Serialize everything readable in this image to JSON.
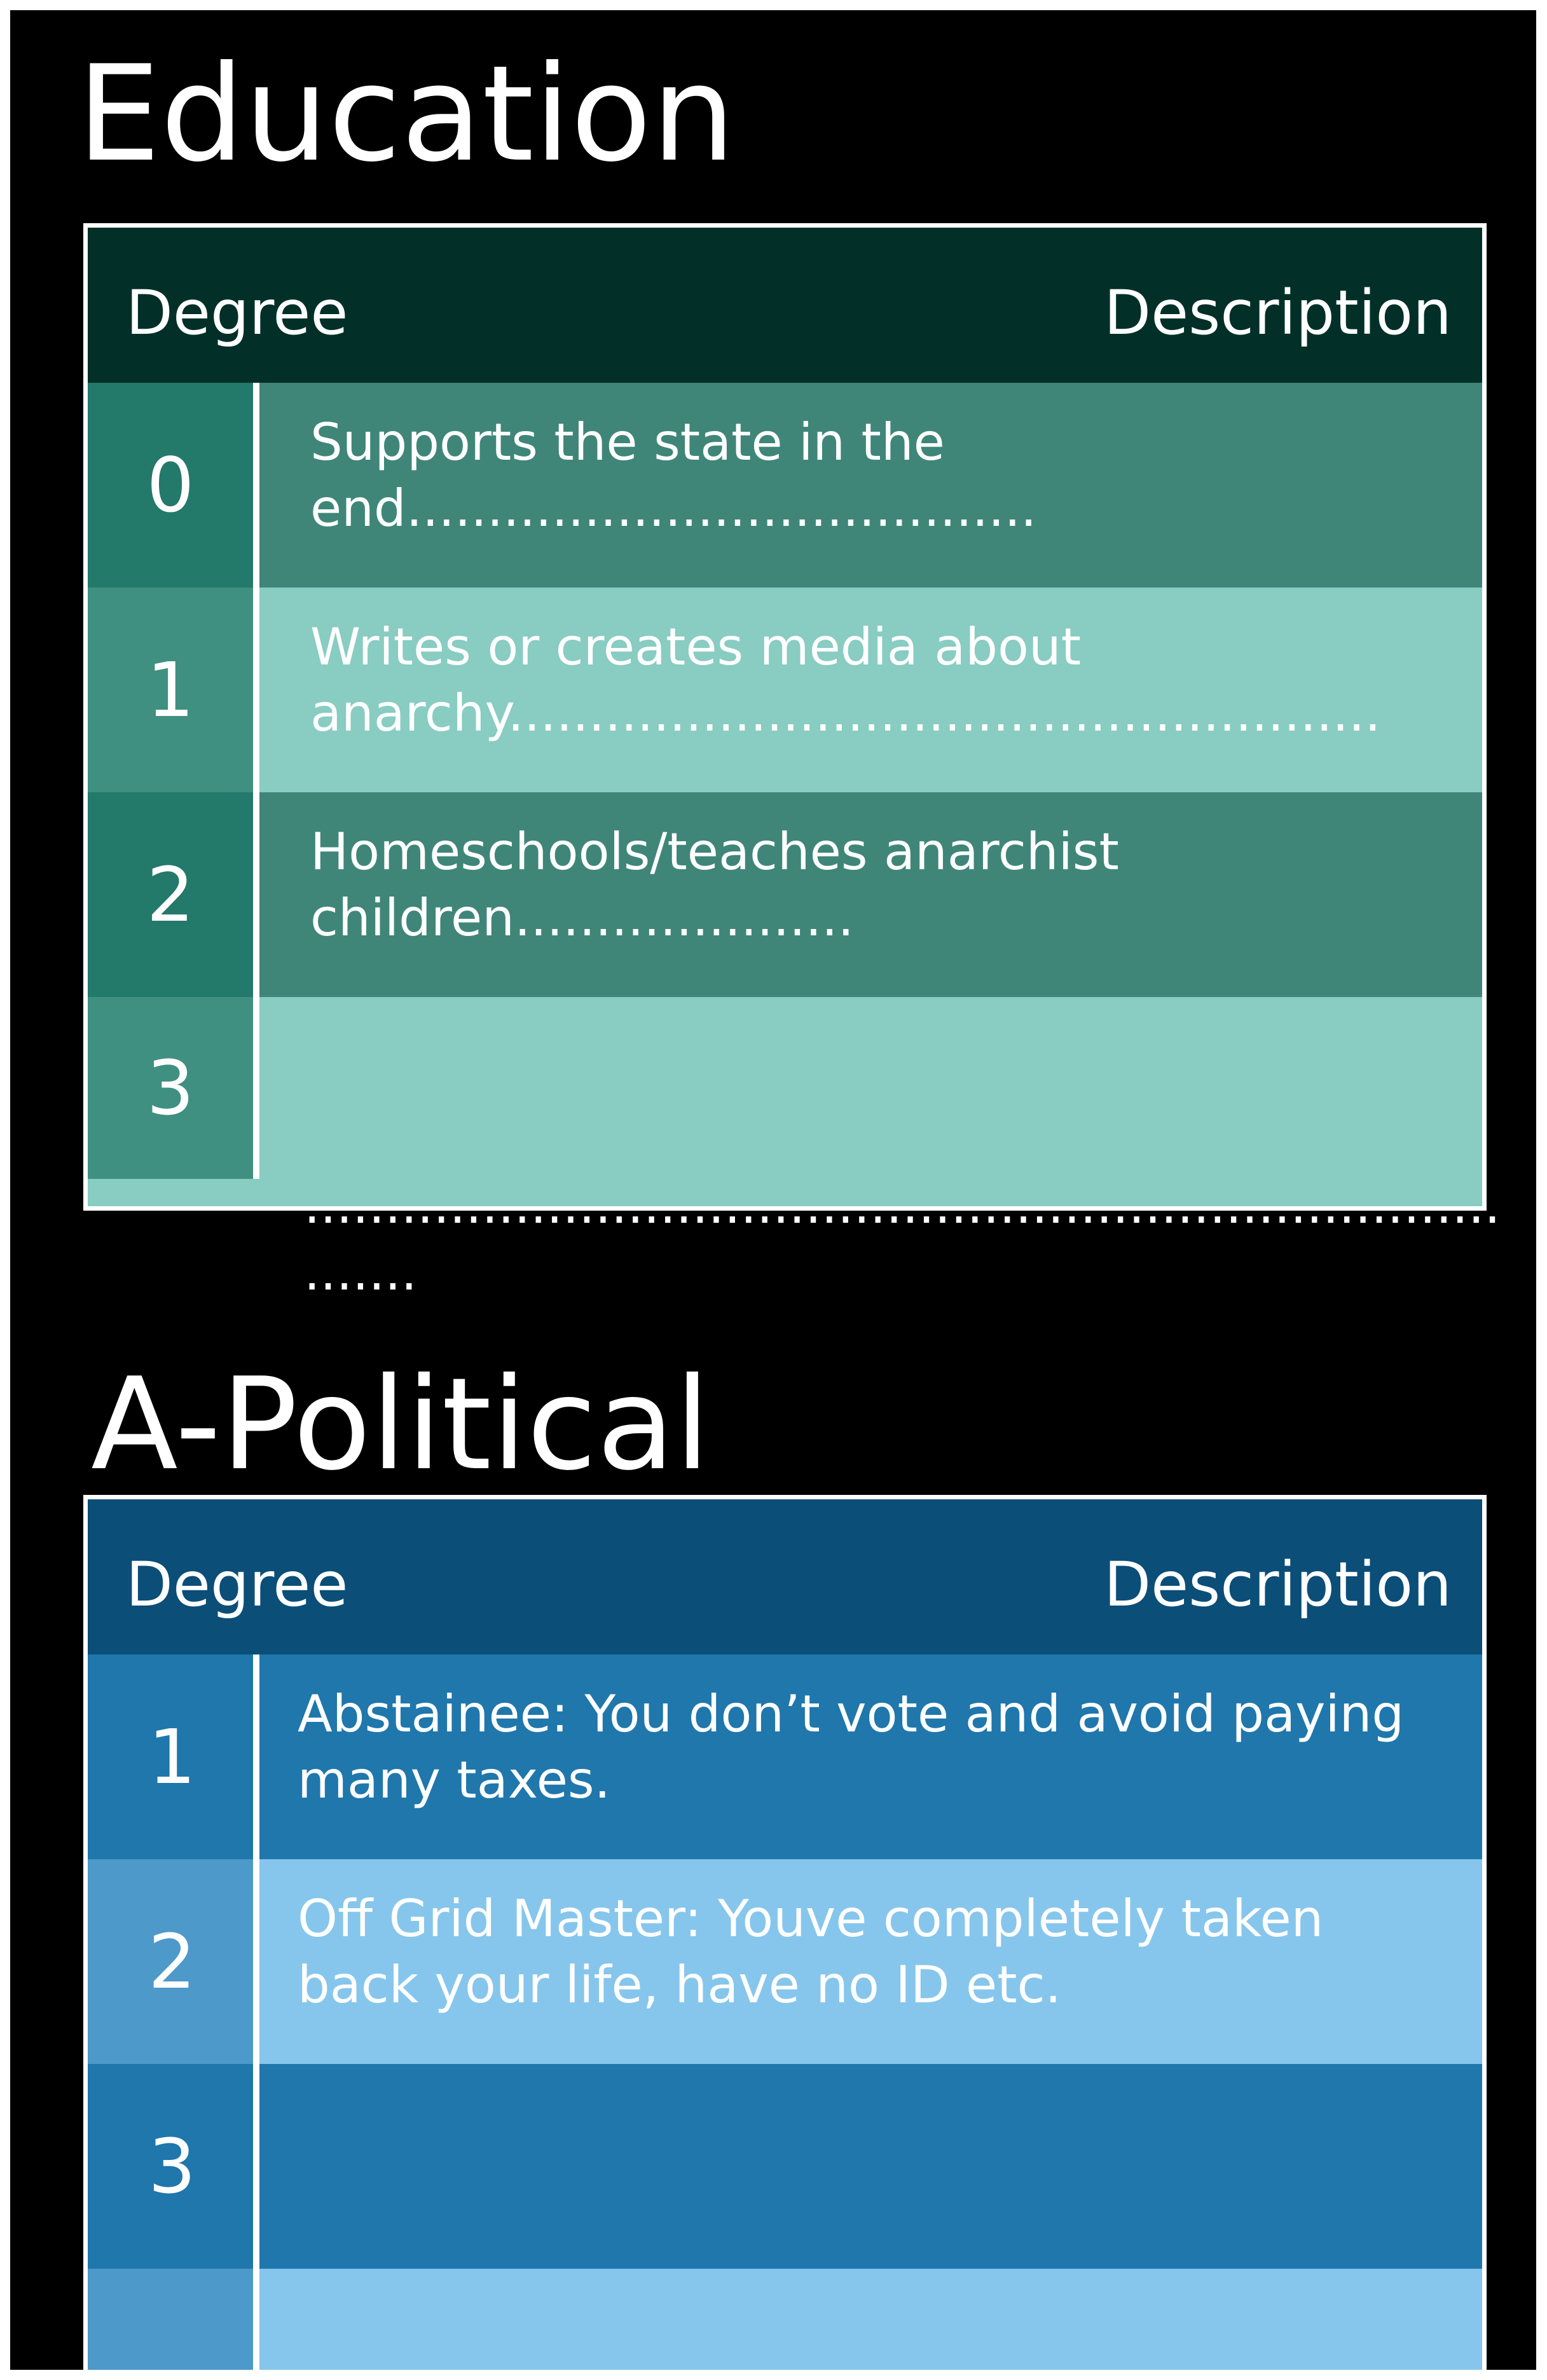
{
  "education": {
    "title": "Education",
    "header": {
      "degree": "Degree",
      "description": "Description"
    },
    "rows": [
      {
        "degree": "0",
        "description": "Supports the state in the end......................................."
      },
      {
        "degree": "1",
        "description": "Writes or creates media about anarchy......................................................"
      },
      {
        "degree": "2",
        "description": "Homeschools/teaches anarchist children....................."
      },
      {
        "degree": "3",
        "description": ""
      }
    ],
    "overflow_line1": "..........................................................................",
    "overflow_line2": "......."
  },
  "apolitical": {
    "title": "A-Political",
    "header": {
      "degree": "Degree",
      "description": "Description"
    },
    "rows": [
      {
        "degree": "1",
        "description": "Abstainee: You don’t vote and avoid paying many taxes."
      },
      {
        "degree": "2",
        "description": "Off Grid Master: Youve completely taken back your life, have no ID etc."
      },
      {
        "degree": "3",
        "description": ""
      },
      {
        "degree": "",
        "description": ""
      }
    ]
  },
  "colors": {
    "education_header": "#023028",
    "education_num_dark": "#23796A",
    "education_num_light": "#3F9080",
    "education_desc_dark": "#3F8679",
    "education_desc_light": "#88CCC2",
    "apolitical_header": "#0B4E78",
    "apolitical_num_dark": "#1F77AC",
    "apolitical_num_light": "#4D99C9",
    "apolitical_desc_dark": "#1F77AC",
    "apolitical_desc_light": "#86C6EC"
  }
}
